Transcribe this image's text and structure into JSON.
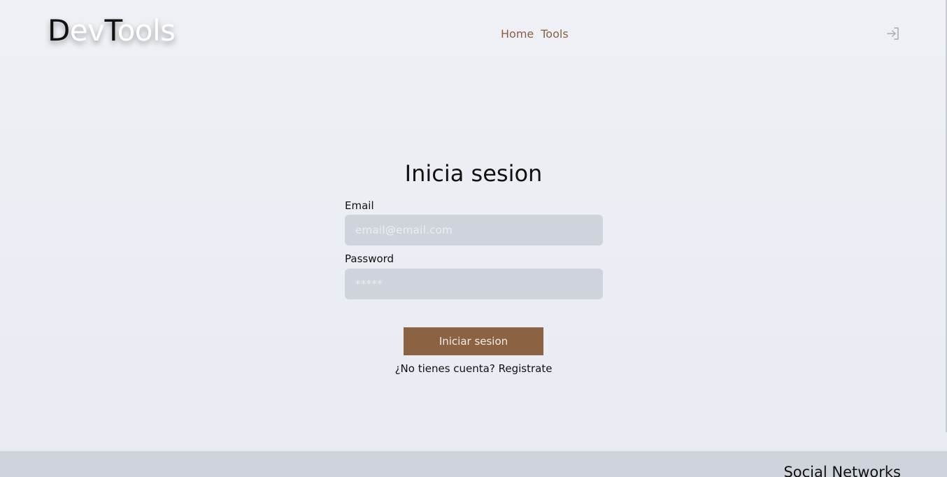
{
  "header": {
    "logo": {
      "part1": "D",
      "part2": "ev",
      "part3": "T",
      "part4": "ools"
    },
    "nav": [
      {
        "label": "Home"
      },
      {
        "label": "Tools"
      }
    ],
    "login_icon": "login-arrow-icon"
  },
  "form": {
    "title": "Inicia sesion",
    "email": {
      "label": "Email",
      "placeholder": "email@email.com",
      "value": ""
    },
    "password": {
      "label": "Password",
      "placeholder": "*****",
      "value": ""
    },
    "submit_label": "Iniciar sesion",
    "register_prompt": "¿No tienes cuenta?",
    "register_link": "Registrate"
  },
  "footer": {
    "title": "Social Networks"
  },
  "colors": {
    "accent": "#8b6242",
    "nav_link": "#8a6242",
    "input_bg": "#cfd4dc",
    "page_bg": "#eef0f5",
    "footer_bg": "#cfd4dc"
  }
}
